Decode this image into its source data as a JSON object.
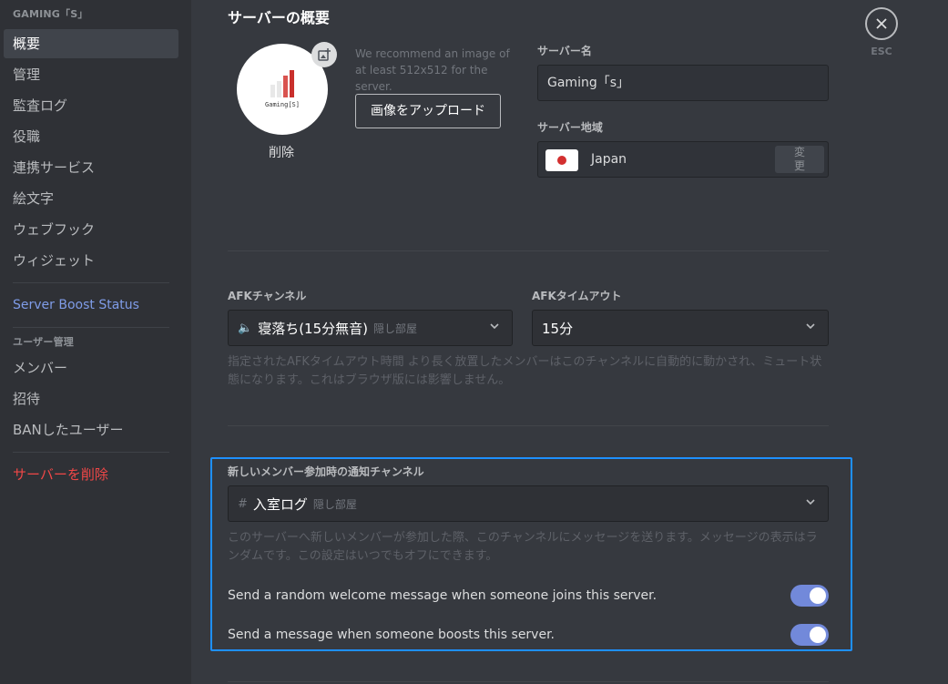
{
  "sidebar": {
    "server_header": "GAMING「S」",
    "items": [
      {
        "label": "概要"
      },
      {
        "label": "管理"
      },
      {
        "label": "監査ログ"
      },
      {
        "label": "役職"
      },
      {
        "label": "連携サービス"
      },
      {
        "label": "絵文字"
      },
      {
        "label": "ウェブフック"
      },
      {
        "label": "ウィジェット"
      }
    ],
    "boost_label": "Server Boost Status",
    "user_mgmt_header": "ユーザー管理",
    "user_items": [
      {
        "label": "メンバー"
      },
      {
        "label": "招待"
      },
      {
        "label": "BANしたユーザー"
      }
    ],
    "delete_server": "サーバーを削除"
  },
  "overview": {
    "title": "サーバーの概要",
    "avatar_text": "Gaming[S]",
    "delete_label": "削除",
    "recommend_text": "We recommend an image of at least 512x512 for the server.",
    "upload_label": "画像をアップロード",
    "server_name_label": "サーバー名",
    "server_name_value": "Gaming「s」",
    "region_label": "サーバー地域",
    "region_value": "Japan",
    "change_label": "変更"
  },
  "afk": {
    "channel_label": "AFKチャンネル",
    "channel_value": "寝落ち(15分無音)",
    "channel_sub": "隠し部屋",
    "timeout_label": "AFKタイムアウト",
    "timeout_value": "15分",
    "help": "指定されたAFKタイムアウト時間 より長く放置したメンバーはこのチャンネルに自動的に動かされ、ミュート状態になります。これはブラウザ版には影響しません。"
  },
  "welcome": {
    "label": "新しいメンバー参加時の通知チャンネル",
    "channel_value": "入室ログ",
    "channel_sub": "隠し部屋",
    "help": "このサーバーへ新しいメンバーが参加した際、このチャンネルにメッセージを送ります。メッセージの表示はランダムです。この設定はいつでもオフにできます。",
    "toggle_welcome": "Send a random welcome message when someone joins this server.",
    "toggle_boost": "Send a message when someone boosts this server."
  },
  "close": {
    "esc_label": "ESC"
  },
  "colors": {
    "accent": "#7289da",
    "danger": "#f04747",
    "highlight": "#1e90ff"
  }
}
